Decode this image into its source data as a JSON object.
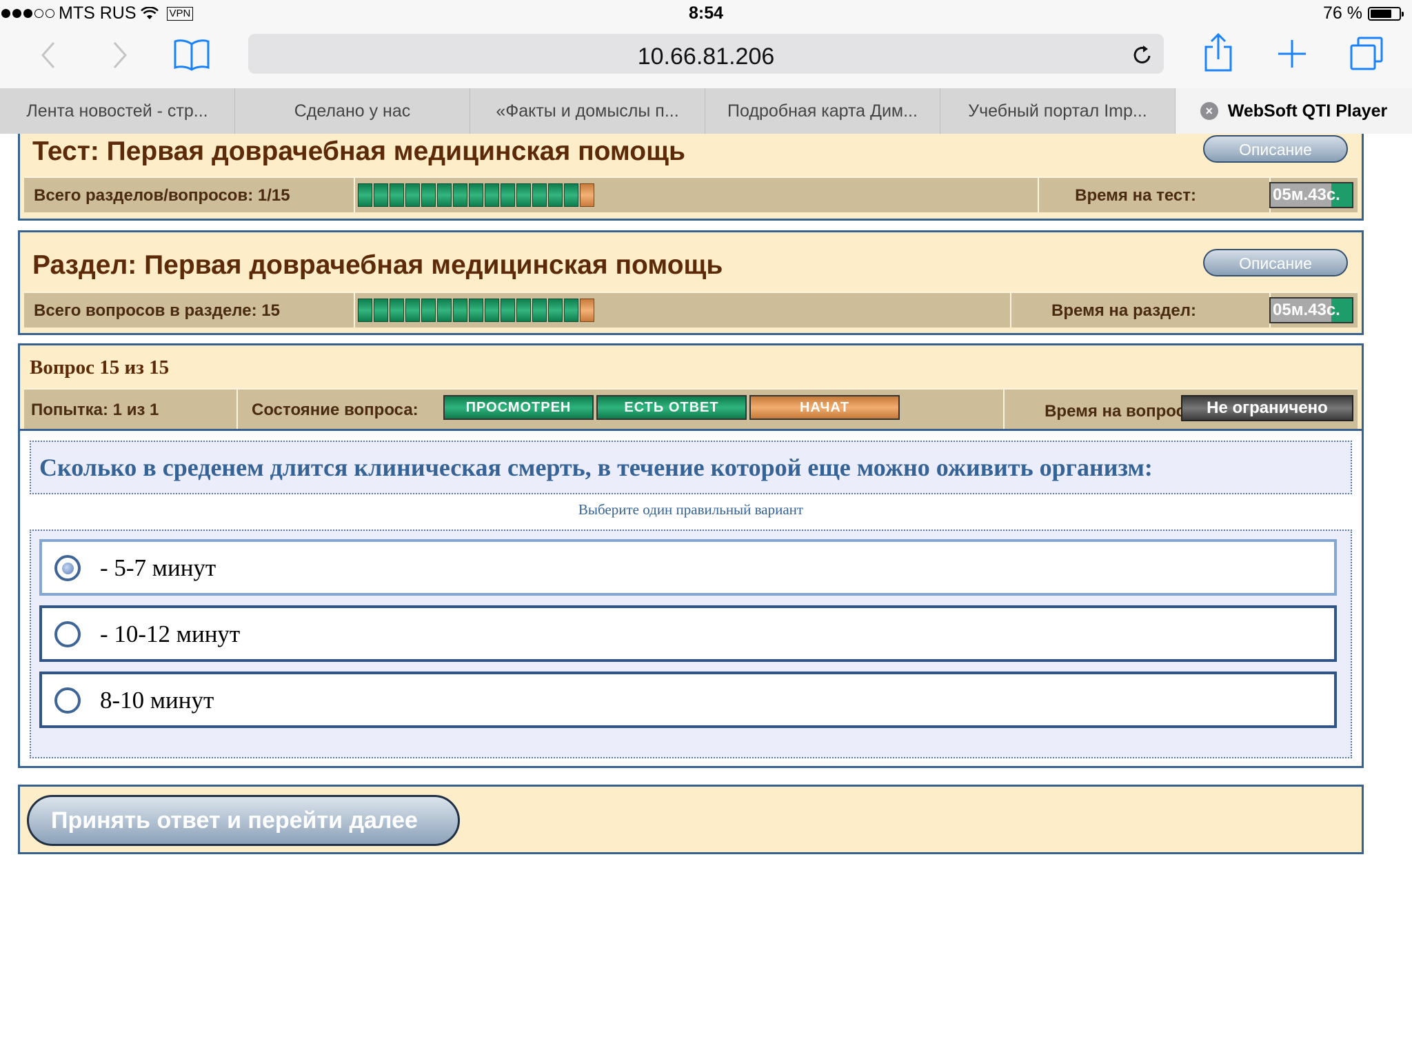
{
  "status_bar": {
    "carrier": "MTS RUS",
    "vpn": "VPN",
    "time": "8:54",
    "battery": "76 %",
    "battery_level": 0.76
  },
  "browser": {
    "url": "10.66.81.206",
    "tabs": [
      {
        "label": "Лента новостей - стр..."
      },
      {
        "label": "Сделано у нас"
      },
      {
        "label": "«Факты и домыслы п..."
      },
      {
        "label": "Подробная карта Дим..."
      },
      {
        "label": "Учебный портал Imp..."
      },
      {
        "label": "WebSoft QTI Player",
        "active": true
      }
    ],
    "icons": [
      "back-icon",
      "forward-icon",
      "bookmarks-icon",
      "reload-icon",
      "share-icon",
      "new-tab-icon",
      "tabs-icon",
      "close-tab-icon"
    ]
  },
  "test": {
    "title": "Тест: Первая доврачебная медицинская помощь",
    "description_label": "Описание",
    "progress_label": "Всего разделов/вопросов: 1/15",
    "progress_done": 14,
    "progress_total": 15,
    "time_label": "Время на тест:",
    "time_value": "05м.43с."
  },
  "section": {
    "title": "Раздел: Первая доврачебная медицинская помощь",
    "description_label": "Описание",
    "progress_label": "Всего вопросов в разделе: 15",
    "progress_done": 14,
    "progress_total": 15,
    "time_label": "Время на раздел:",
    "time_value": "05м.43с."
  },
  "question_info": {
    "header": "Вопрос 15 из 15",
    "attempt": "Попытка: 1 из 1",
    "state_label": "Состояние вопроса:",
    "states": [
      "ПРОСМОТРЕН",
      "ЕСТЬ ОТВЕТ",
      "НАЧАТ"
    ],
    "time_label": "Время на вопрос:",
    "time_value": "Не ограничено"
  },
  "question": {
    "text": "Сколько в среденем длится клиническая смерть, в течение которой еще можно оживить организм:",
    "hint": "Выберите один правильный вариант",
    "options": [
      {
        "label": "- 5-7 минут",
        "selected": true
      },
      {
        "label": "- 10-12 минут",
        "selected": false
      },
      {
        "label": "8-10 минут",
        "selected": false
      }
    ]
  },
  "submit_label": "Принять ответ и перейти далее",
  "colors": {
    "panel_bg": "#fdedc9",
    "panel_border": "#36608f",
    "row_bg": "#cdbd99",
    "title": "#5c2a08",
    "progress_green": "#1e9c69",
    "progress_orange": "#f1ad6f",
    "question_text": "#356395",
    "ios_blue": "#1a82fb"
  }
}
